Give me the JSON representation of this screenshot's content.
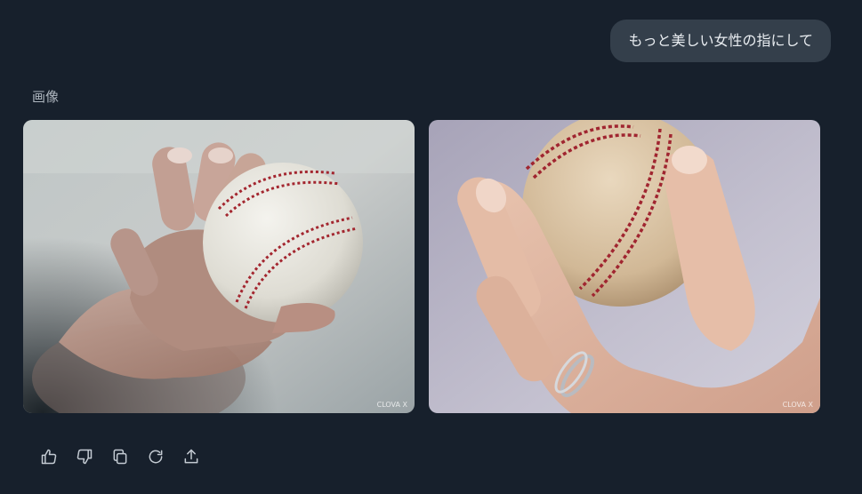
{
  "chat": {
    "user_message": "もっと美しい女性の指にして",
    "section_label": "画像",
    "images": [
      {
        "watermark": "CLOVA X"
      },
      {
        "watermark": "CLOVA X"
      }
    ]
  },
  "actions": [
    {
      "icon": "thumbs-up-icon"
    },
    {
      "icon": "thumbs-down-icon"
    },
    {
      "icon": "copy-icon"
    },
    {
      "icon": "regenerate-icon"
    },
    {
      "icon": "share-icon"
    }
  ],
  "colors": {
    "background": "#17202c",
    "bubble": "#343f4b",
    "text": "#e9edf1",
    "muted": "#aeb6bf",
    "icon": "#c3cad2",
    "stitch": "#a3262f"
  }
}
